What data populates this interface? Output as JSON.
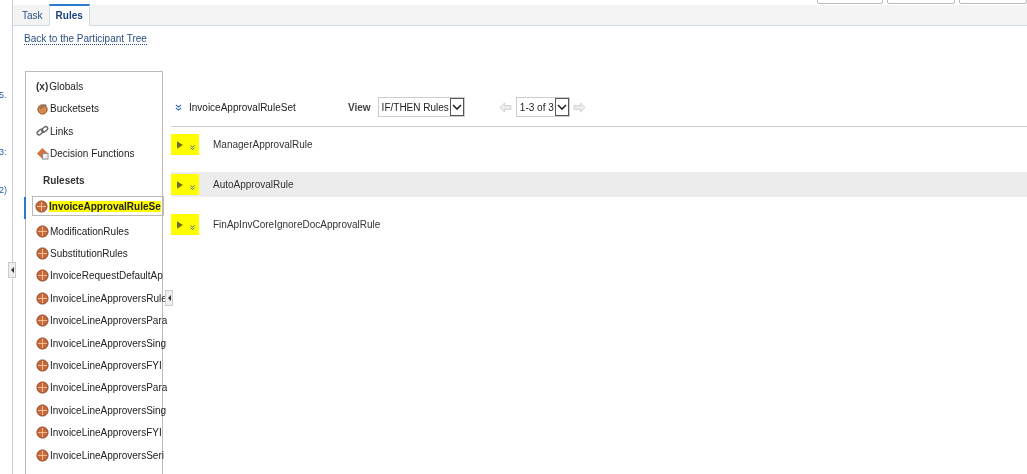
{
  "left_strip": {
    "fragments": [
      "5.",
      "3:",
      "2)"
    ]
  },
  "tabs": [
    {
      "label": "Task",
      "selected": false
    },
    {
      "label": "Rules",
      "selected": true
    }
  ],
  "back_link": "Back to the Participant Tree",
  "sidebar": {
    "items": [
      {
        "kind": "globals",
        "glyph": "(x)",
        "label": "Globals"
      },
      {
        "kind": "bucketsets",
        "label": "Bucketsets"
      },
      {
        "kind": "links",
        "label": "Links"
      },
      {
        "kind": "functions",
        "label": "Decision Functions"
      }
    ],
    "rulesets_heading": "Rulesets",
    "rulesets": [
      {
        "label": "InvoiceApprovalRuleSe",
        "selected": true,
        "highlighted": true
      },
      {
        "label": "ModificationRules",
        "selected": false,
        "highlighted": false
      },
      {
        "label": "SubstitutionRules",
        "selected": false,
        "highlighted": false
      },
      {
        "label": "InvoiceRequestDefaultAp",
        "selected": false,
        "highlighted": false
      },
      {
        "label": "InvoiceLineApproversRule",
        "selected": false,
        "highlighted": false
      },
      {
        "label": "InvoiceLineApproversPara",
        "selected": false,
        "highlighted": false
      },
      {
        "label": "InvoiceLineApproversSing",
        "selected": false,
        "highlighted": false
      },
      {
        "label": "InvoiceLineApproversFYI",
        "selected": false,
        "highlighted": false
      },
      {
        "label": "InvoiceLineApproversPara",
        "selected": false,
        "highlighted": false
      },
      {
        "label": "InvoiceLineApproversSing",
        "selected": false,
        "highlighted": false
      },
      {
        "label": "InvoiceLineApproversFYI",
        "selected": false,
        "highlighted": false
      },
      {
        "label": "InvoiceLineApproversSeri",
        "selected": false,
        "highlighted": false
      }
    ]
  },
  "ruleset": {
    "name": "InvoiceApprovalRuleSet",
    "view_label": "View",
    "view_value": "IF/THEN Rules",
    "pager_value": "1-3 of 3"
  },
  "rules": [
    {
      "name": "ManagerApprovalRule",
      "selected": false,
      "highlighted": true
    },
    {
      "name": "AutoApprovalRule",
      "selected": true,
      "highlighted": true
    },
    {
      "name": "FinApInvCoreIgnoreDocApprovalRule",
      "selected": false,
      "highlighted": true
    }
  ]
}
